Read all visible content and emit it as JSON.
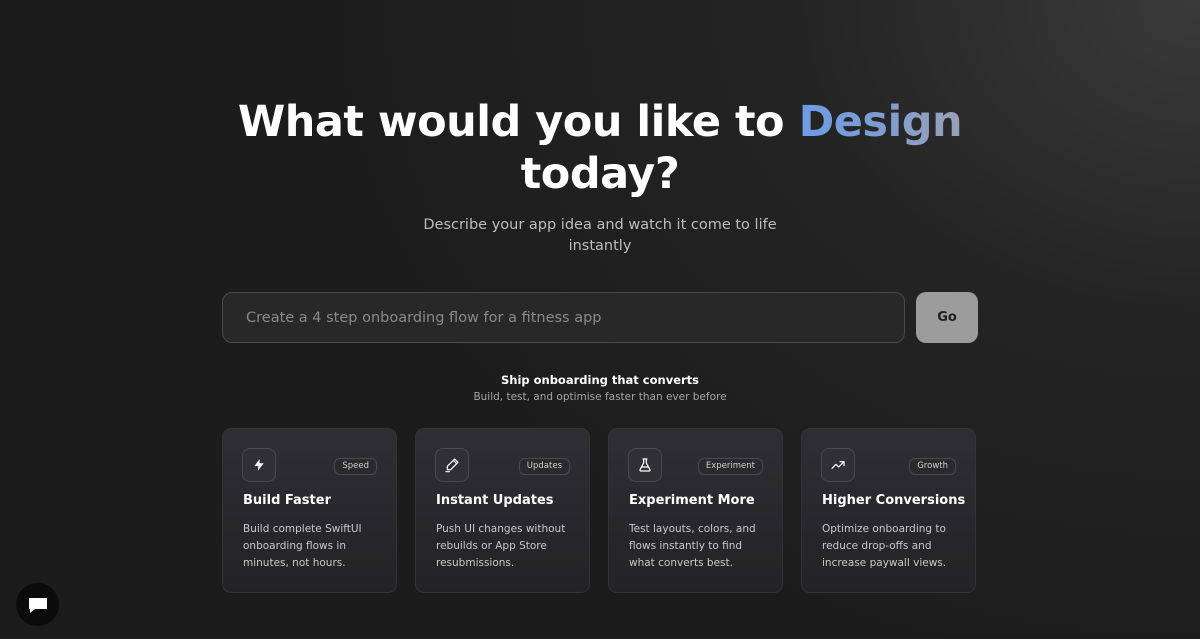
{
  "hero": {
    "title_prefix": "What would you like to ",
    "title_accent": "Design",
    "title_suffix": "today?",
    "subtitle": "Describe your app idea and watch it come to life instantly"
  },
  "prompt": {
    "placeholder": "Create a 4 step onboarding flow for a fitness app",
    "value": "",
    "go_label": "Go"
  },
  "section": {
    "title": "Ship onboarding that converts",
    "subtitle": "Build, test, and optimise faster than ever before"
  },
  "cards": [
    {
      "icon": "lightning-icon",
      "badge": "Speed",
      "title": "Build Faster",
      "description": "Build complete SwiftUI onboarding flows in minutes, not hours."
    },
    {
      "icon": "pencil-icon",
      "badge": "Updates",
      "title": "Instant Updates",
      "description": "Push UI changes without rebuilds or App Store resubmissions."
    },
    {
      "icon": "flask-icon",
      "badge": "Experiment",
      "title": "Experiment More",
      "description": "Test layouts, colors, and flows instantly to find what converts best."
    },
    {
      "icon": "trending-up-icon",
      "badge": "Growth",
      "title": "Higher Conversions",
      "description": "Optimize onboarding to reduce drop-offs and increase paywall views."
    }
  ],
  "chat": {
    "icon": "chat-bubble-icon"
  },
  "colors": {
    "accent_start": "#6d9ce6",
    "accent_end": "#9aa3b5",
    "background": "#1c1c1c",
    "go_button": "#9c9c9c"
  }
}
